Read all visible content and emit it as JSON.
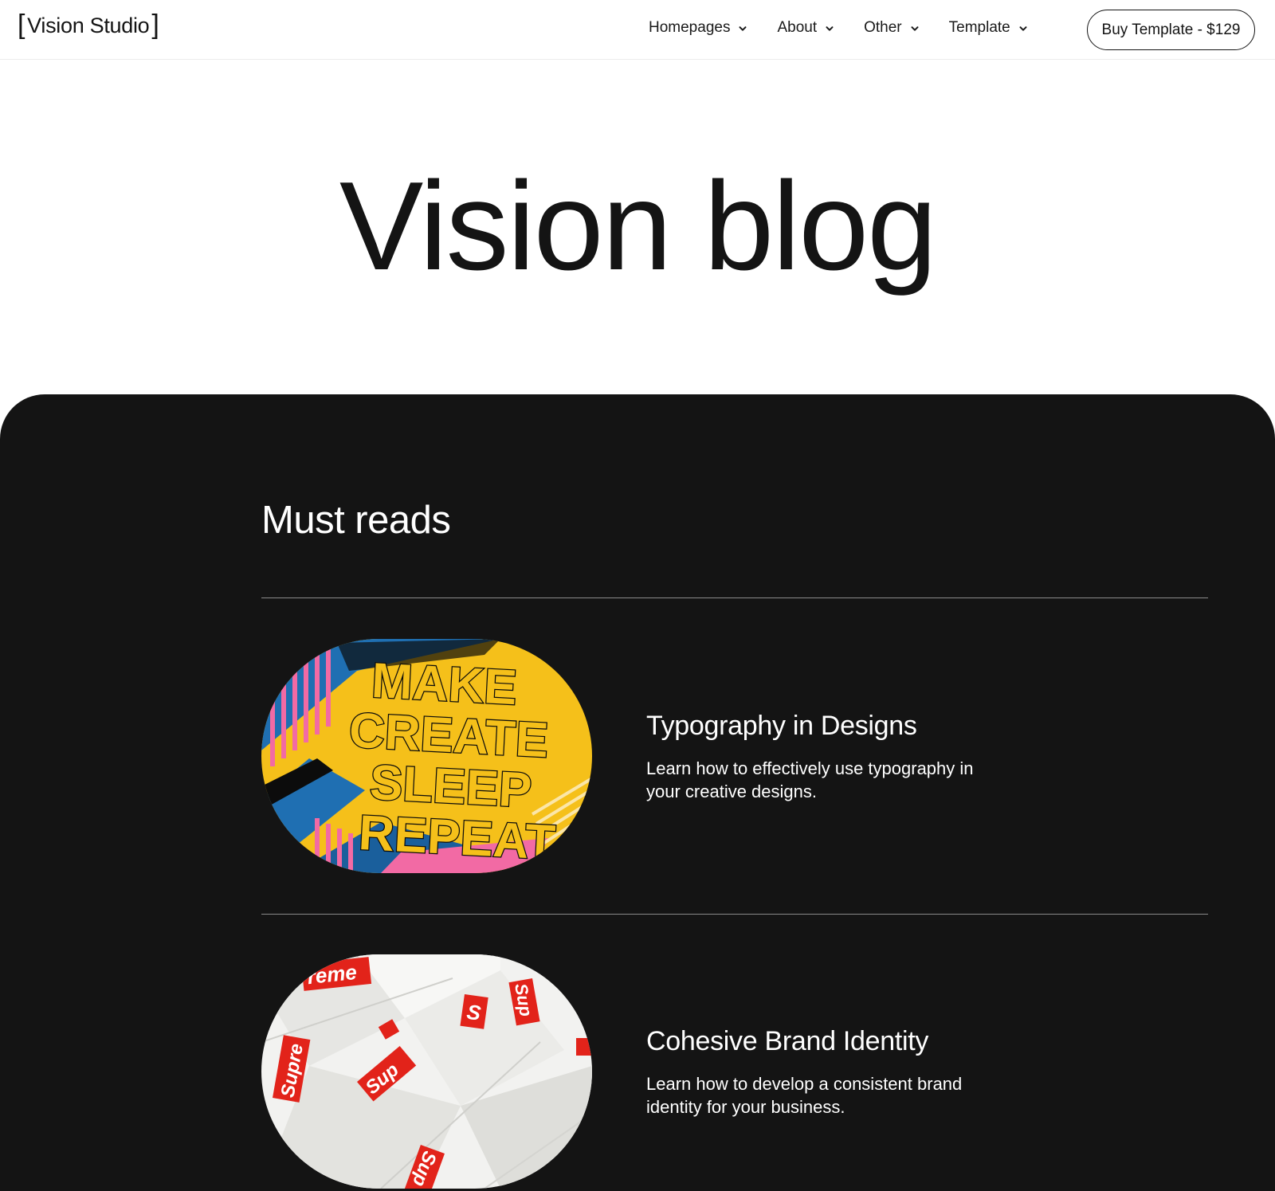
{
  "header": {
    "logo": {
      "bracket_open": "[",
      "text": "Vision Studio",
      "bracket_close": "]"
    },
    "nav": [
      {
        "label": "Homepages",
        "icon": "chevron-down-icon"
      },
      {
        "label": "About",
        "icon": "chevron-down-icon"
      },
      {
        "label": "Other",
        "icon": "chevron-down-icon"
      },
      {
        "label": "Template",
        "icon": "chevron-down-icon"
      }
    ],
    "cta_label": "Buy Template - $129"
  },
  "hero": {
    "title": "Vision blog"
  },
  "must_reads": {
    "title": "Must reads",
    "posts": [
      {
        "title": "Typography in Designs",
        "description": "Learn how to effectively use typography in your creative designs.",
        "image": {
          "lines": [
            "MAKE",
            "CREATE",
            "SLEEP",
            "REPEAT"
          ]
        }
      },
      {
        "title": "Cohesive Brand Identity",
        "description": "Learn how to develop a consistent brand identity for your business.",
        "image": {
          "sticker_texts": [
            "reme",
            "S",
            "Sup",
            "Supre",
            "Sup",
            "Sup"
          ]
        }
      }
    ]
  },
  "colors": {
    "dark_background": "#141414",
    "text_dark": "#141414",
    "text_light": "#ffffff",
    "divider": "#8a8a8a",
    "accent_yellow": "#f5c91a",
    "accent_blue": "#1f6fb2",
    "accent_pink": "#f26aa4",
    "accent_red": "#e2231a"
  }
}
